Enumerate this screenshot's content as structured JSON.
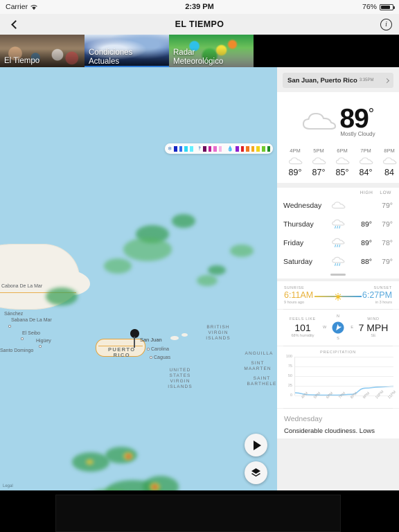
{
  "status_bar": {
    "carrier": "Carrier",
    "wifi_icon": "wifi-icon",
    "time": "2:39 PM",
    "battery_percent": "76%",
    "battery_icon": "battery-icon"
  },
  "nav": {
    "back_icon": "chevron-left-icon",
    "title": "EL TIEMPO",
    "info_icon": "info-icon"
  },
  "tiles": [
    {
      "label_line1": "El Tiempo",
      "label_line2": "",
      "active": false
    },
    {
      "label_line1": "Condiciones",
      "label_line2": "Actuales",
      "active": true
    },
    {
      "label_line1": "Radar",
      "label_line2": "Meteorológico",
      "active": false
    }
  ],
  "map": {
    "legend": {
      "snow_icon": "snowflake-icon",
      "mix_icon": "mixed-precip-icon",
      "rain_icon": "raindrop-icon",
      "snow_colors": [
        "#1526c4",
        "#2f6ef0",
        "#2fd8f5",
        "#66f0ff"
      ],
      "mix_colors": [
        "#6d0b5c",
        "#c01f9a",
        "#e86ccd",
        "#f6b6e6"
      ],
      "rain_colors": [
        "#8c1fd0",
        "#e02020",
        "#f07820",
        "#f5a81c",
        "#f0d41a",
        "#6ec92e",
        "#1f8c24"
      ]
    },
    "labels": [
      "Sánchez",
      "Sabana De La Mar",
      "El Seibo",
      "Higüey",
      "Santo Domingo",
      "Cabona De La Mar",
      "San Juan",
      "Carolina",
      "Caguas",
      "PUERTO RICO",
      "BRITISH VIRGIN ISLANDS",
      "UNITED STATES VIRGIN ISLANDS",
      "ANGUILLA",
      "SINT MAARTEN",
      "SAINT BARTHELEMY"
    ],
    "pin_label": "San Juan",
    "play_button_icon": "play-icon",
    "layers_button_icon": "layers-icon",
    "legal": "Legal"
  },
  "panel": {
    "location": {
      "name": "San Juan, Puerto Rico",
      "time": "3:35PM",
      "chevron_icon": "chevron-right-icon"
    },
    "current": {
      "icon": "cloud-icon",
      "temperature": "89",
      "degree": "°",
      "condition": "Mostly Cloudy"
    },
    "hourly": [
      {
        "hour": "4PM",
        "icon": "cloud-icon",
        "temp": "89°"
      },
      {
        "hour": "5PM",
        "icon": "cloud-icon",
        "temp": "87°"
      },
      {
        "hour": "6PM",
        "icon": "cloud-icon",
        "temp": "85°"
      },
      {
        "hour": "7PM",
        "icon": "cloud-icon",
        "temp": "84°"
      },
      {
        "hour": "8PM",
        "icon": "cloud-icon",
        "temp": "84"
      }
    ],
    "daily_header": {
      "high": "HIGH",
      "low": "LOW"
    },
    "daily": [
      {
        "day": "Wednesday",
        "icon": "cloud-icon",
        "high": "",
        "low": "79°"
      },
      {
        "day": "Thursday",
        "icon": "rain-icon",
        "high": "89°",
        "low": "79°"
      },
      {
        "day": "Friday",
        "icon": "rain-icon",
        "high": "89°",
        "low": "78°"
      },
      {
        "day": "Saturday",
        "icon": "rain-icon",
        "high": "88°",
        "low": "79°"
      }
    ],
    "sun": {
      "sunrise_label": "SUNRISE",
      "sunrise_time": "6:11AM",
      "sunrise_sub": "9 hours ago",
      "sunset_label": "SUNSET",
      "sunset_time": "6:27PM",
      "sunset_sub": "in 3 hours",
      "sun_icon": "sun-icon"
    },
    "metrics": {
      "feels_like_label": "FEELS LIKE",
      "feels_like_value": "101",
      "humidity_sub": "68% humidity",
      "compass": {
        "n": "N",
        "s": "S",
        "e": "E",
        "w": "W",
        "icon": "compass-icon"
      },
      "wind_label": "WIND",
      "wind_value": "7 MPH",
      "wind_dir": "SE"
    },
    "summary": {
      "day": "Wednesday",
      "text": "Considerable cloudiness. Lows"
    }
  },
  "chart_data": {
    "type": "line",
    "title": "PRECIPITATION",
    "xlabel": "",
    "ylabel": "",
    "categories": [
      "4PM",
      "5PM",
      "6PM",
      "7PM",
      "8PM",
      "9PM",
      "10PM",
      "11PM"
    ],
    "values": [
      7,
      2,
      1,
      1,
      3,
      19,
      22,
      24
    ],
    "ylim": [
      0,
      100
    ],
    "yticks": [
      0,
      25,
      50,
      75,
      100
    ],
    "line_color": "#8ecaf0",
    "grid": true,
    "legend": "none"
  }
}
